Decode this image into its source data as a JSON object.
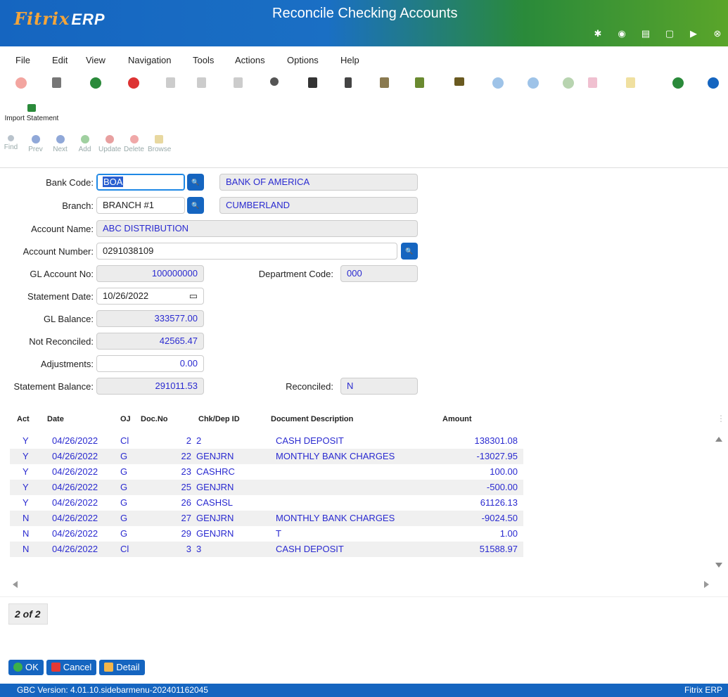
{
  "header": {
    "logo": "Fitrix",
    "logo_suffix": "ERP",
    "title": "Reconcile Checking Accounts",
    "icons": [
      "gear-icon",
      "globe-icon",
      "document-icon",
      "new-page-icon",
      "play-icon",
      "close-icon"
    ]
  },
  "menu": [
    "File",
    "Edit",
    "View",
    "Navigation",
    "Tools",
    "Actions",
    "Options",
    "Help"
  ],
  "toolbar": {
    "import_label": "Import Statement"
  },
  "nav": {
    "find": "Find",
    "prev": "Prev",
    "next": "Next",
    "add": "Add",
    "update": "Update",
    "delete": "Delete",
    "browse": "Browse"
  },
  "form": {
    "bank_code_label": "Bank Code:",
    "bank_code": "BOA",
    "bank_name": "BANK OF AMERICA",
    "branch_label": "Branch:",
    "branch": "BRANCH #1",
    "branch_name": "CUMBERLAND",
    "account_name_label": "Account Name:",
    "account_name": "ABC DISTRIBUTION",
    "account_number_label": "Account Number:",
    "account_number": "0291038109",
    "gl_account_label": "GL Account No:",
    "gl_account": "100000000",
    "department_label": "Department Code:",
    "department": "000",
    "statement_date_label": "Statement Date:",
    "statement_date": "10/26/2022",
    "gl_balance_label": "GL Balance:",
    "gl_balance": "333577.00",
    "not_reconciled_label": "Not Reconciled:",
    "not_reconciled": "42565.47",
    "adjustments_label": "Adjustments:",
    "adjustments": "0.00",
    "statement_balance_label": "Statement Balance:",
    "statement_balance": "291011.53",
    "reconciled_label": "Reconciled:",
    "reconciled": "N"
  },
  "grid": {
    "columns": [
      "Act",
      "Date",
      "OJ",
      "Doc.No",
      "Chk/Dep ID",
      "Document Description",
      "Amount"
    ],
    "rows": [
      {
        "act": "Y",
        "date": "04/26/2022",
        "oj": "Cl",
        "docno": "2",
        "chk": "2",
        "desc": "CASH DEPOSIT",
        "amount": "138301.08"
      },
      {
        "act": "Y",
        "date": "04/26/2022",
        "oj": "G",
        "docno": "22",
        "chk": "GENJRN",
        "desc": "MONTHLY BANK CHARGES",
        "amount": "-13027.95"
      },
      {
        "act": "Y",
        "date": "04/26/2022",
        "oj": "G",
        "docno": "23",
        "chk": "CASHRC",
        "desc": "",
        "amount": "100.00"
      },
      {
        "act": "Y",
        "date": "04/26/2022",
        "oj": "G",
        "docno": "25",
        "chk": "GENJRN",
        "desc": "",
        "amount": "-500.00"
      },
      {
        "act": "Y",
        "date": "04/26/2022",
        "oj": "G",
        "docno": "26",
        "chk": "CASHSL",
        "desc": "",
        "amount": "61126.13"
      },
      {
        "act": "N",
        "date": "04/26/2022",
        "oj": "G",
        "docno": "27",
        "chk": "GENJRN",
        "desc": "MONTHLY BANK CHARGES",
        "amount": "-9024.50"
      },
      {
        "act": "N",
        "date": "04/26/2022",
        "oj": "G",
        "docno": "29",
        "chk": "GENJRN",
        "desc": "T",
        "amount": "1.00"
      },
      {
        "act": "N",
        "date": "04/26/2022",
        "oj": "Cl",
        "docno": "3",
        "chk": "3",
        "desc": "CASH DEPOSIT",
        "amount": "51588.97"
      }
    ]
  },
  "pager": "2 of 2",
  "buttons": {
    "ok": "OK",
    "cancel": "Cancel",
    "detail": "Detail"
  },
  "status": {
    "version": "GBC Version: 4.01.10.sidebarmenu-202401162045",
    "brand": "Fitrix ERP"
  },
  "colors": {
    "accent": "#1565c0",
    "value_text": "#2a2ad0",
    "header_green": "#5aa52a"
  }
}
